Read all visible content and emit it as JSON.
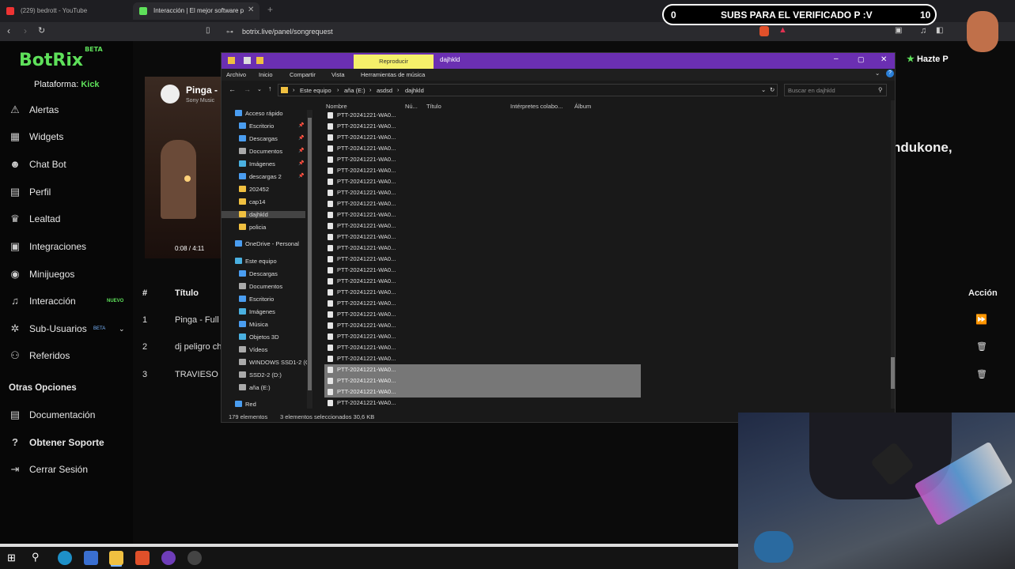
{
  "browser": {
    "tabs": [
      {
        "label": "(229) bedrott - YouTube",
        "color": "#e33"
      },
      {
        "label": "Interacción | El mejor software p",
        "color": "#5ee05a"
      }
    ],
    "url": "botrix.live/panel/songrequest"
  },
  "overlay": {
    "left": "0",
    "text": "SUBS PARA EL VERIFICADO P :V",
    "right": "10"
  },
  "sidebar": {
    "logo": "BotRix",
    "logo_badge": "BETA",
    "platform_label": "Plataforma:",
    "platform_value": "Kick",
    "items": [
      {
        "label": "Alertas",
        "icon": "warning-icon"
      },
      {
        "label": "Widgets",
        "icon": "grid-icon"
      },
      {
        "label": "Chat Bot",
        "icon": "robot-icon"
      },
      {
        "label": "Perfil",
        "icon": "id-card-icon"
      },
      {
        "label": "Lealtad",
        "icon": "trophy-icon"
      },
      {
        "label": "Integraciones",
        "icon": "integrations-icon"
      },
      {
        "label": "Minijuegos",
        "icon": "gamepad-icon"
      },
      {
        "label": "Interacción",
        "icon": "music-icon",
        "tag": "NUEVO"
      },
      {
        "label": "Sub-Usuarios",
        "icon": "users-icon",
        "tag": "BETA"
      },
      {
        "label": "Referidos",
        "icon": "group-icon"
      }
    ],
    "other_title": "Otras Opciones",
    "other_items": [
      {
        "label": "Documentación",
        "icon": "doc-icon"
      },
      {
        "label": "Obtener Soporte",
        "icon": "help-icon"
      },
      {
        "label": "Cerrar Sesión",
        "icon": "logout-icon"
      }
    ]
  },
  "player": {
    "title": "Pinga -",
    "artist": "Sony Music",
    "time": "0:08 / 4:11",
    "right_text": "ndukone,",
    "hazte": "Hazte P"
  },
  "queue": {
    "headers": {
      "num": "#",
      "title": "Título",
      "action": "Acción"
    },
    "rows": [
      {
        "num": "1",
        "title": "Pinga - Full V"
      },
      {
        "num": "2",
        "title": "dj peligro ch"
      },
      {
        "num": "3",
        "title": "TRAVIESO"
      }
    ]
  },
  "explorer": {
    "title_tab": "Reproducir",
    "folder_title": "dajhkld",
    "ribbon": [
      "Archivo",
      "Inicio",
      "Compartir",
      "Vista",
      "Herramientas de música"
    ],
    "path": [
      "Este equipo",
      "aña (E:)",
      "asdsd",
      "dajhkld"
    ],
    "search_placeholder": "Buscar en dajhkld",
    "columns": [
      "Nombre",
      "Nú...",
      "Título",
      "Intérpretes colabo...",
      "Álbum"
    ],
    "nav": [
      {
        "label": "Acceso rápido",
        "indent": 0,
        "color": "#4a9df0",
        "pin": false
      },
      {
        "label": "Escritorio",
        "indent": 1,
        "color": "#4a9df0",
        "pin": true
      },
      {
        "label": "Descargas",
        "indent": 1,
        "color": "#4a9df0",
        "pin": true
      },
      {
        "label": "Documentos",
        "indent": 1,
        "color": "#aaa",
        "pin": true
      },
      {
        "label": "Imágenes",
        "indent": 1,
        "color": "#4ab0e0",
        "pin": true
      },
      {
        "label": "descargas 2",
        "indent": 1,
        "color": "#4a9df0",
        "pin": true
      },
      {
        "label": "202452",
        "indent": 1,
        "color": "#f0c040",
        "pin": false
      },
      {
        "label": "cap14",
        "indent": 1,
        "color": "#f0c040",
        "pin": false
      },
      {
        "label": "dajhkld",
        "indent": 1,
        "color": "#f0c040",
        "pin": false,
        "sel": true
      },
      {
        "label": "policia",
        "indent": 1,
        "color": "#f0c040",
        "pin": false
      },
      {
        "label": "OneDrive - Personal",
        "indent": 0,
        "color": "#4a9df0",
        "pin": false
      },
      {
        "label": "Este equipo",
        "indent": 0,
        "color": "#4ab0e0",
        "pin": false
      },
      {
        "label": "Descargas",
        "indent": 1,
        "color": "#4a9df0",
        "pin": false
      },
      {
        "label": "Documentos",
        "indent": 1,
        "color": "#aaa",
        "pin": false
      },
      {
        "label": "Escritorio",
        "indent": 1,
        "color": "#4a9df0",
        "pin": false
      },
      {
        "label": "Imágenes",
        "indent": 1,
        "color": "#4ab0e0",
        "pin": false
      },
      {
        "label": "Música",
        "indent": 1,
        "color": "#4a9df0",
        "pin": false
      },
      {
        "label": "Objetos 3D",
        "indent": 1,
        "color": "#4ab0e0",
        "pin": false
      },
      {
        "label": "Vídeos",
        "indent": 1,
        "color": "#aaa",
        "pin": false
      },
      {
        "label": "WINDOWS SSD1-2 (C",
        "indent": 1,
        "color": "#aaa",
        "pin": false
      },
      {
        "label": "SSD2-2 (D:)",
        "indent": 1,
        "color": "#aaa",
        "pin": false
      },
      {
        "label": "aña (E:)",
        "indent": 1,
        "color": "#aaa",
        "pin": false
      },
      {
        "label": "Red",
        "indent": 0,
        "color": "#4a9df0",
        "pin": false
      }
    ],
    "file_name": "PTT-20241221-WA0...",
    "file_count_visible": 27,
    "selected_indexes": [
      23,
      24,
      25
    ],
    "status_count": "179 elementos",
    "status_sel": "3 elementos seleccionados  30,6 KB"
  }
}
